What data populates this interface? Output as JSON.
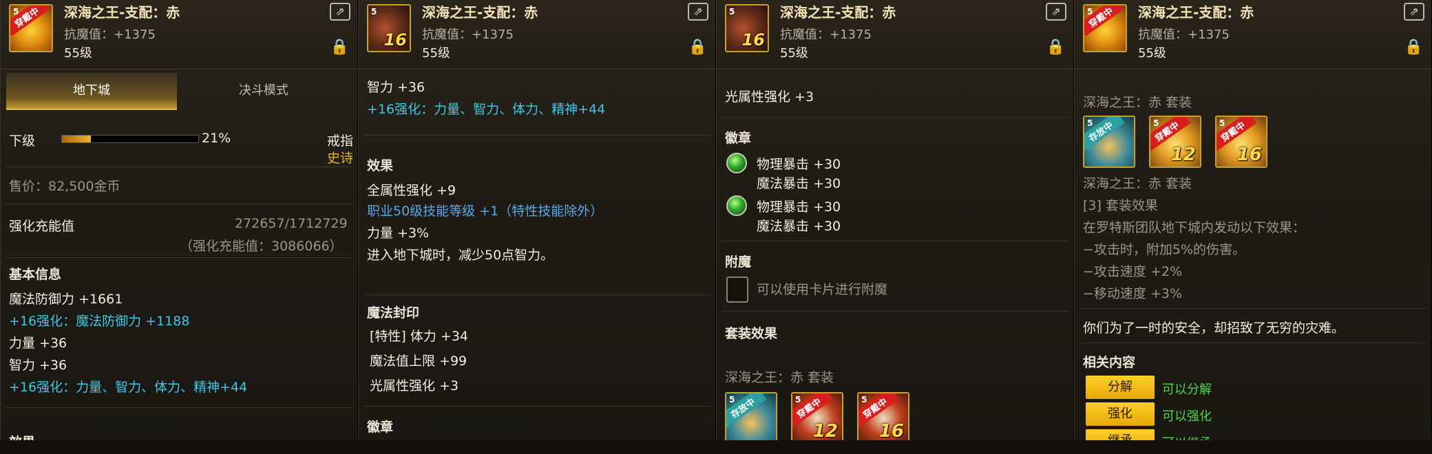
{
  "item": {
    "title": "深海之王-支配：赤",
    "resist": "抗魔值：+1375",
    "level": "55级",
    "lv_badge": "5",
    "enhance_num": "16"
  },
  "p1": {
    "tabs": [
      "地下城",
      "决斗模式"
    ],
    "grade": "下级",
    "grade_pct": "21%",
    "grade_progress": 0.21,
    "slot": "戒指",
    "rarity": "史诗",
    "price": "售价：82,500金币",
    "charge_label": "强化充能值",
    "charge_val": "272657/1712729",
    "charge_total": "（强化充能值：3086066）",
    "basic_title": "基本信息",
    "lines": [
      "魔法防御力 +1661",
      "+16强化：魔法防御力 +1188",
      "力量 +36",
      "智力 +36",
      "+16强化：力量、智力、体力、精神+44"
    ],
    "effect_title": "效果"
  },
  "p2": {
    "lines_top": [
      "智力 +36",
      "+16强化：力量、智力、体力、精神+44"
    ],
    "effect_title": "效果",
    "effects": [
      "全属性强化 +9",
      "职业50级技能等级 +1（特性技能除外）",
      "力量 +3%",
      "进入地下城时，减少50点智力。"
    ],
    "seal_title": "魔法封印",
    "seals": [
      "[特性] 体力 +34",
      "魔法值上限 +99",
      "光属性强化 +3"
    ],
    "emblem_title": "徽章"
  },
  "p3": {
    "top_line": "光属性强化 +3",
    "emblem_title": "徽章",
    "emblems": [
      [
        "物理暴击 +30",
        "魔法暴击 +30"
      ],
      [
        "物理暴击 +30",
        "魔法暴击 +30"
      ]
    ],
    "enchant_title": "附魔",
    "enchant_text": "可以使用卡片进行附魔",
    "set_title": "套装效果",
    "set_name": "深海之王：赤 套装",
    "set_icons": [
      {
        "lv": "5",
        "tag": "存放中",
        "num": ""
      },
      {
        "lv": "5",
        "tag": "穿戴中",
        "num": "12"
      },
      {
        "lv": "5",
        "tag": "穿戴中",
        "num": "16"
      }
    ]
  },
  "p4": {
    "set_name": "深海之王：赤 套装",
    "set_icons": [
      {
        "lv": "5",
        "tag": "存放中",
        "num": ""
      },
      {
        "lv": "5",
        "tag": "穿戴中",
        "num": "12"
      },
      {
        "lv": "5",
        "tag": "穿戴中",
        "num": "16"
      }
    ],
    "set_name2": "深海之王：赤 套装",
    "set_effect": "[3] 套装效果",
    "set_lines": [
      "在罗特斯团队地下城内发动以下效果：",
      "−攻击时，附加5%的伤害。",
      "−攻击速度 +2%",
      "−移动速度 +3%"
    ],
    "flavor": "你们为了一时的安全，却招致了无穷的灾难。",
    "related_title": "相关内容",
    "buttons": [
      {
        "label": "分解",
        "desc": "可以分解"
      },
      {
        "label": "强化",
        "desc": "可以强化"
      },
      {
        "label": "继承",
        "desc": "可以继承"
      }
    ]
  },
  "colors": {
    "cyan": "#3ec8e6",
    "gold": "#e8b42c",
    "green": "#52d64a",
    "button": "#f5bb18"
  }
}
